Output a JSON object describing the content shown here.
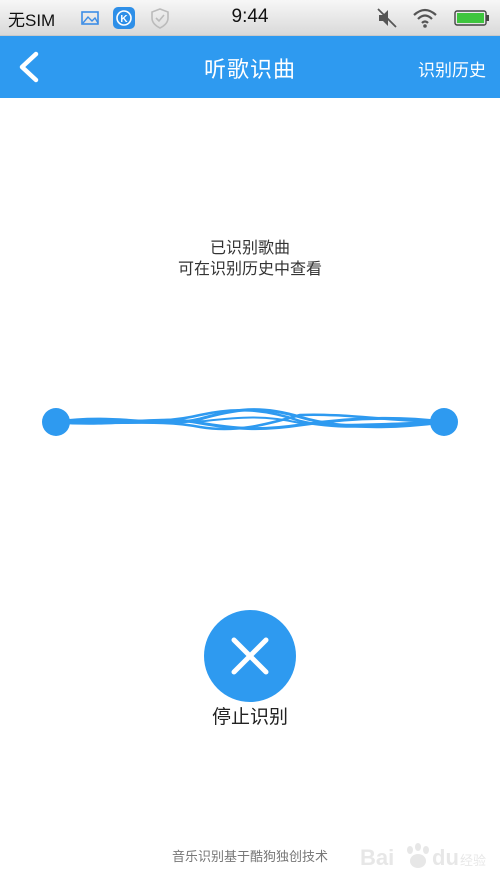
{
  "status_bar": {
    "carrier": "无SIM",
    "time": "9:44",
    "icons": [
      "image-icon",
      "kugou-app-icon",
      "shield-icon",
      "mute-icon",
      "wifi-icon",
      "battery-icon"
    ],
    "battery_color": "#3ec53e"
  },
  "header": {
    "title": "听歌识曲",
    "history_label": "识别历史",
    "back_icon": "chevron-left-icon",
    "background": "#2e9af0"
  },
  "message": {
    "line1": "已识别歌曲",
    "line2": "可在识别历史中查看"
  },
  "stop": {
    "icon": "close-icon",
    "label": "停止识别"
  },
  "footer": {
    "text": "音乐识别基于酷狗独创技术"
  },
  "watermark": {
    "text": "Bai du 经验"
  }
}
